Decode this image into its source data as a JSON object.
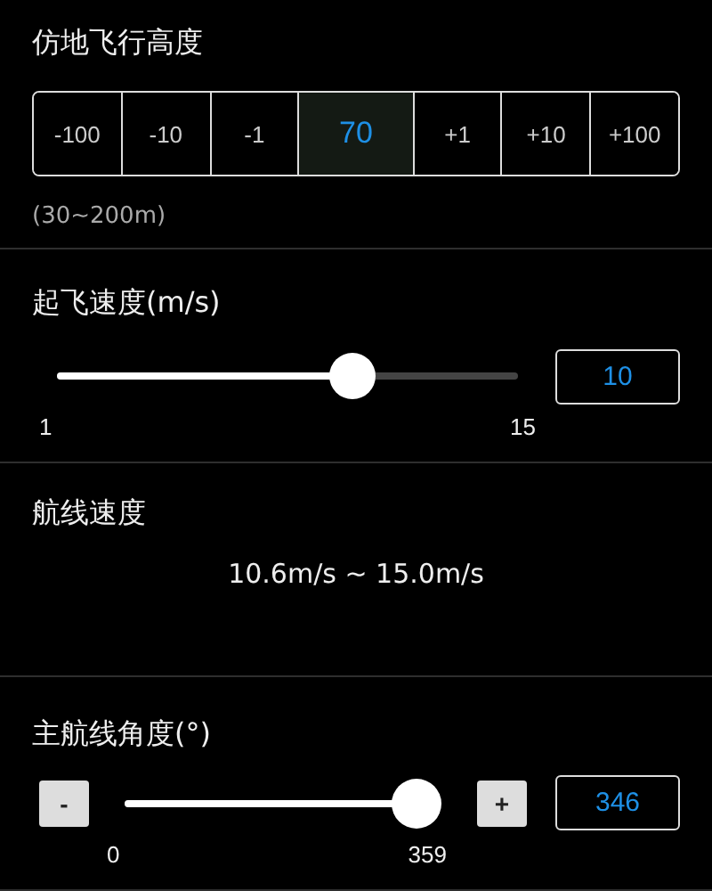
{
  "sections": [
    {
      "kind": "stepper",
      "title": "仿地飞行高度",
      "steps": [
        {
          "label": "-100",
          "selected": false
        },
        {
          "label": "-10",
          "selected": false
        },
        {
          "label": "-1",
          "selected": false
        },
        {
          "label": "70",
          "selected": true
        },
        {
          "label": "+1",
          "selected": false
        },
        {
          "label": "+10",
          "selected": false
        },
        {
          "label": "+100",
          "selected": false
        }
      ],
      "hint": "(30~200m)"
    },
    {
      "kind": "slider",
      "title": "起飞速度(m/s)",
      "level": 0.64,
      "min_label": "1",
      "max_label": "15",
      "value": "10"
    },
    {
      "kind": "readout",
      "title": "航线速度",
      "value": "10.6m/s ~ 15.0m/s"
    },
    {
      "kind": "slider",
      "title": "主航线角度(°)",
      "level": 0.96,
      "min_label": "0",
      "max_label": "359",
      "value": "346",
      "decrement": "-",
      "increment": "+"
    }
  ]
}
